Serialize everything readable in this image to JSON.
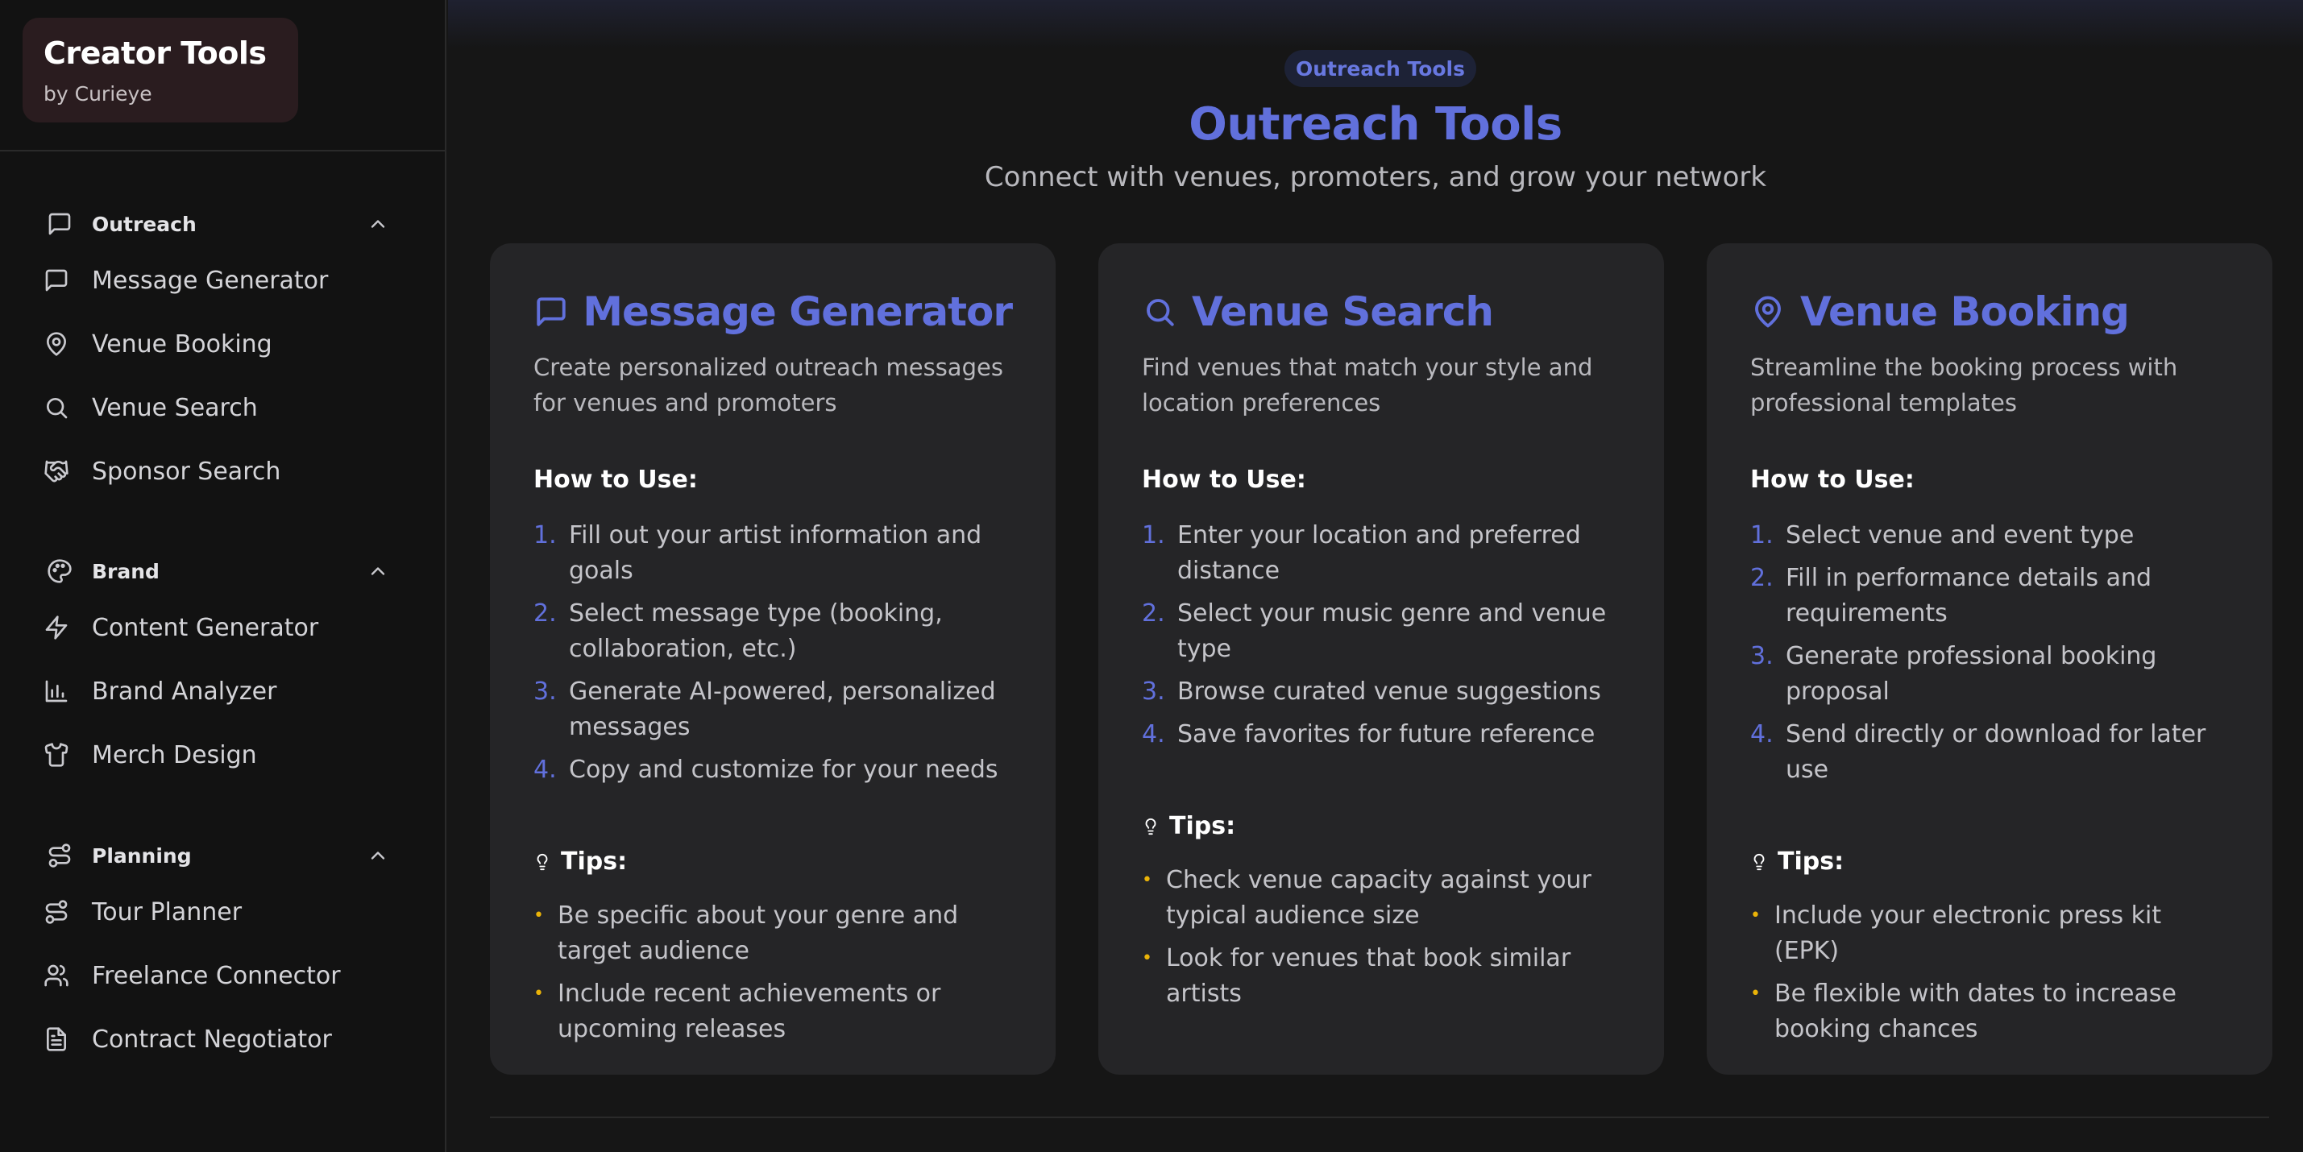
{
  "brand": {
    "title": "Creator Tools",
    "subtitle": "by Curieye"
  },
  "sidebar": {
    "sections": [
      {
        "label": "Outreach",
        "icon": "message-square-icon",
        "items": [
          {
            "label": "Message Generator",
            "icon": "message-square-icon"
          },
          {
            "label": "Venue Booking",
            "icon": "map-pin-icon"
          },
          {
            "label": "Venue Search",
            "icon": "search-icon"
          },
          {
            "label": "Sponsor Search",
            "icon": "handshake-icon"
          }
        ]
      },
      {
        "label": "Brand",
        "icon": "palette-icon",
        "items": [
          {
            "label": "Content Generator",
            "icon": "zap-icon"
          },
          {
            "label": "Brand Analyzer",
            "icon": "bar-chart-icon"
          },
          {
            "label": "Merch Design",
            "icon": "shirt-icon"
          }
        ]
      },
      {
        "label": "Planning",
        "icon": "route-icon",
        "items": [
          {
            "label": "Tour Planner",
            "icon": "route-icon"
          },
          {
            "label": "Freelance Connector",
            "icon": "users-icon"
          },
          {
            "label": "Contract Negotiator",
            "icon": "file-text-icon"
          }
        ]
      }
    ]
  },
  "main": {
    "badge": "Outreach Tools",
    "title": "Outreach Tools",
    "subtitle": "Connect with venues, promoters, and grow your network",
    "how_to_label": "How to Use:",
    "tips_label": "Tips:",
    "cards": [
      {
        "title": "Message Generator",
        "icon": "message-square-icon",
        "description": "Create personalized outreach messages for venues and promoters",
        "steps": [
          "Fill out your artist information and goals",
          "Select message type (booking, collaboration, etc.)",
          "Generate AI-powered, personalized messages",
          "Copy and customize for your needs"
        ],
        "tips": [
          "Be specific about your genre and target audience",
          "Include recent achievements or upcoming releases"
        ]
      },
      {
        "title": "Venue Search",
        "icon": "search-icon",
        "description": "Find venues that match your style and location preferences",
        "steps": [
          "Enter your location and preferred distance",
          "Select your music genre and venue type",
          "Browse curated venue suggestions",
          "Save favorites for future reference"
        ],
        "tips": [
          "Check venue capacity against your typical audience size",
          "Look for venues that book similar artists"
        ]
      },
      {
        "title": "Venue Booking",
        "icon": "map-pin-icon",
        "description": "Streamline the booking process with professional templates",
        "steps": [
          "Select venue and event type",
          "Fill in performance details and requirements",
          "Generate professional booking proposal",
          "Send directly or download for later use"
        ],
        "tips": [
          "Include your electronic press kit (EPK)",
          "Be flexible with dates to increase booking chances"
        ]
      }
    ]
  },
  "colors": {
    "accent": "#6170dc",
    "tip_bullet": "#eab308",
    "brand_card": "#2a1c1f",
    "card_bg": "#252527"
  }
}
